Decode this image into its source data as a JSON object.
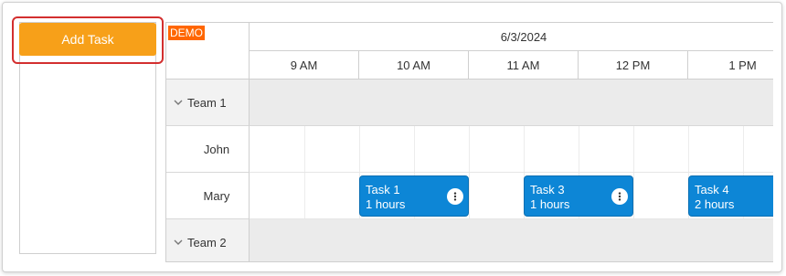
{
  "sidebar": {
    "add_task_label": "Add Task"
  },
  "scheduler": {
    "demo_badge": "DEMO",
    "date": "6/3/2024",
    "hours": [
      "9 AM",
      "10 AM",
      "11 AM",
      "12 PM",
      "1 PM"
    ],
    "rows": [
      {
        "name": "Team 1",
        "type": "group"
      },
      {
        "name": "John",
        "type": "resource"
      },
      {
        "name": "Mary",
        "type": "resource"
      },
      {
        "name": "Team 2",
        "type": "group"
      }
    ],
    "events": [
      {
        "title": "Task 1",
        "duration": "1 hours"
      },
      {
        "title": "Task 3",
        "duration": "1 hours"
      },
      {
        "title": "Task 4",
        "duration": "2 hours"
      }
    ]
  },
  "colors": {
    "button": "#f7a019",
    "event": "#0d86d6",
    "demo_badge": "#ff6600",
    "highlight": "#d32f2f"
  }
}
